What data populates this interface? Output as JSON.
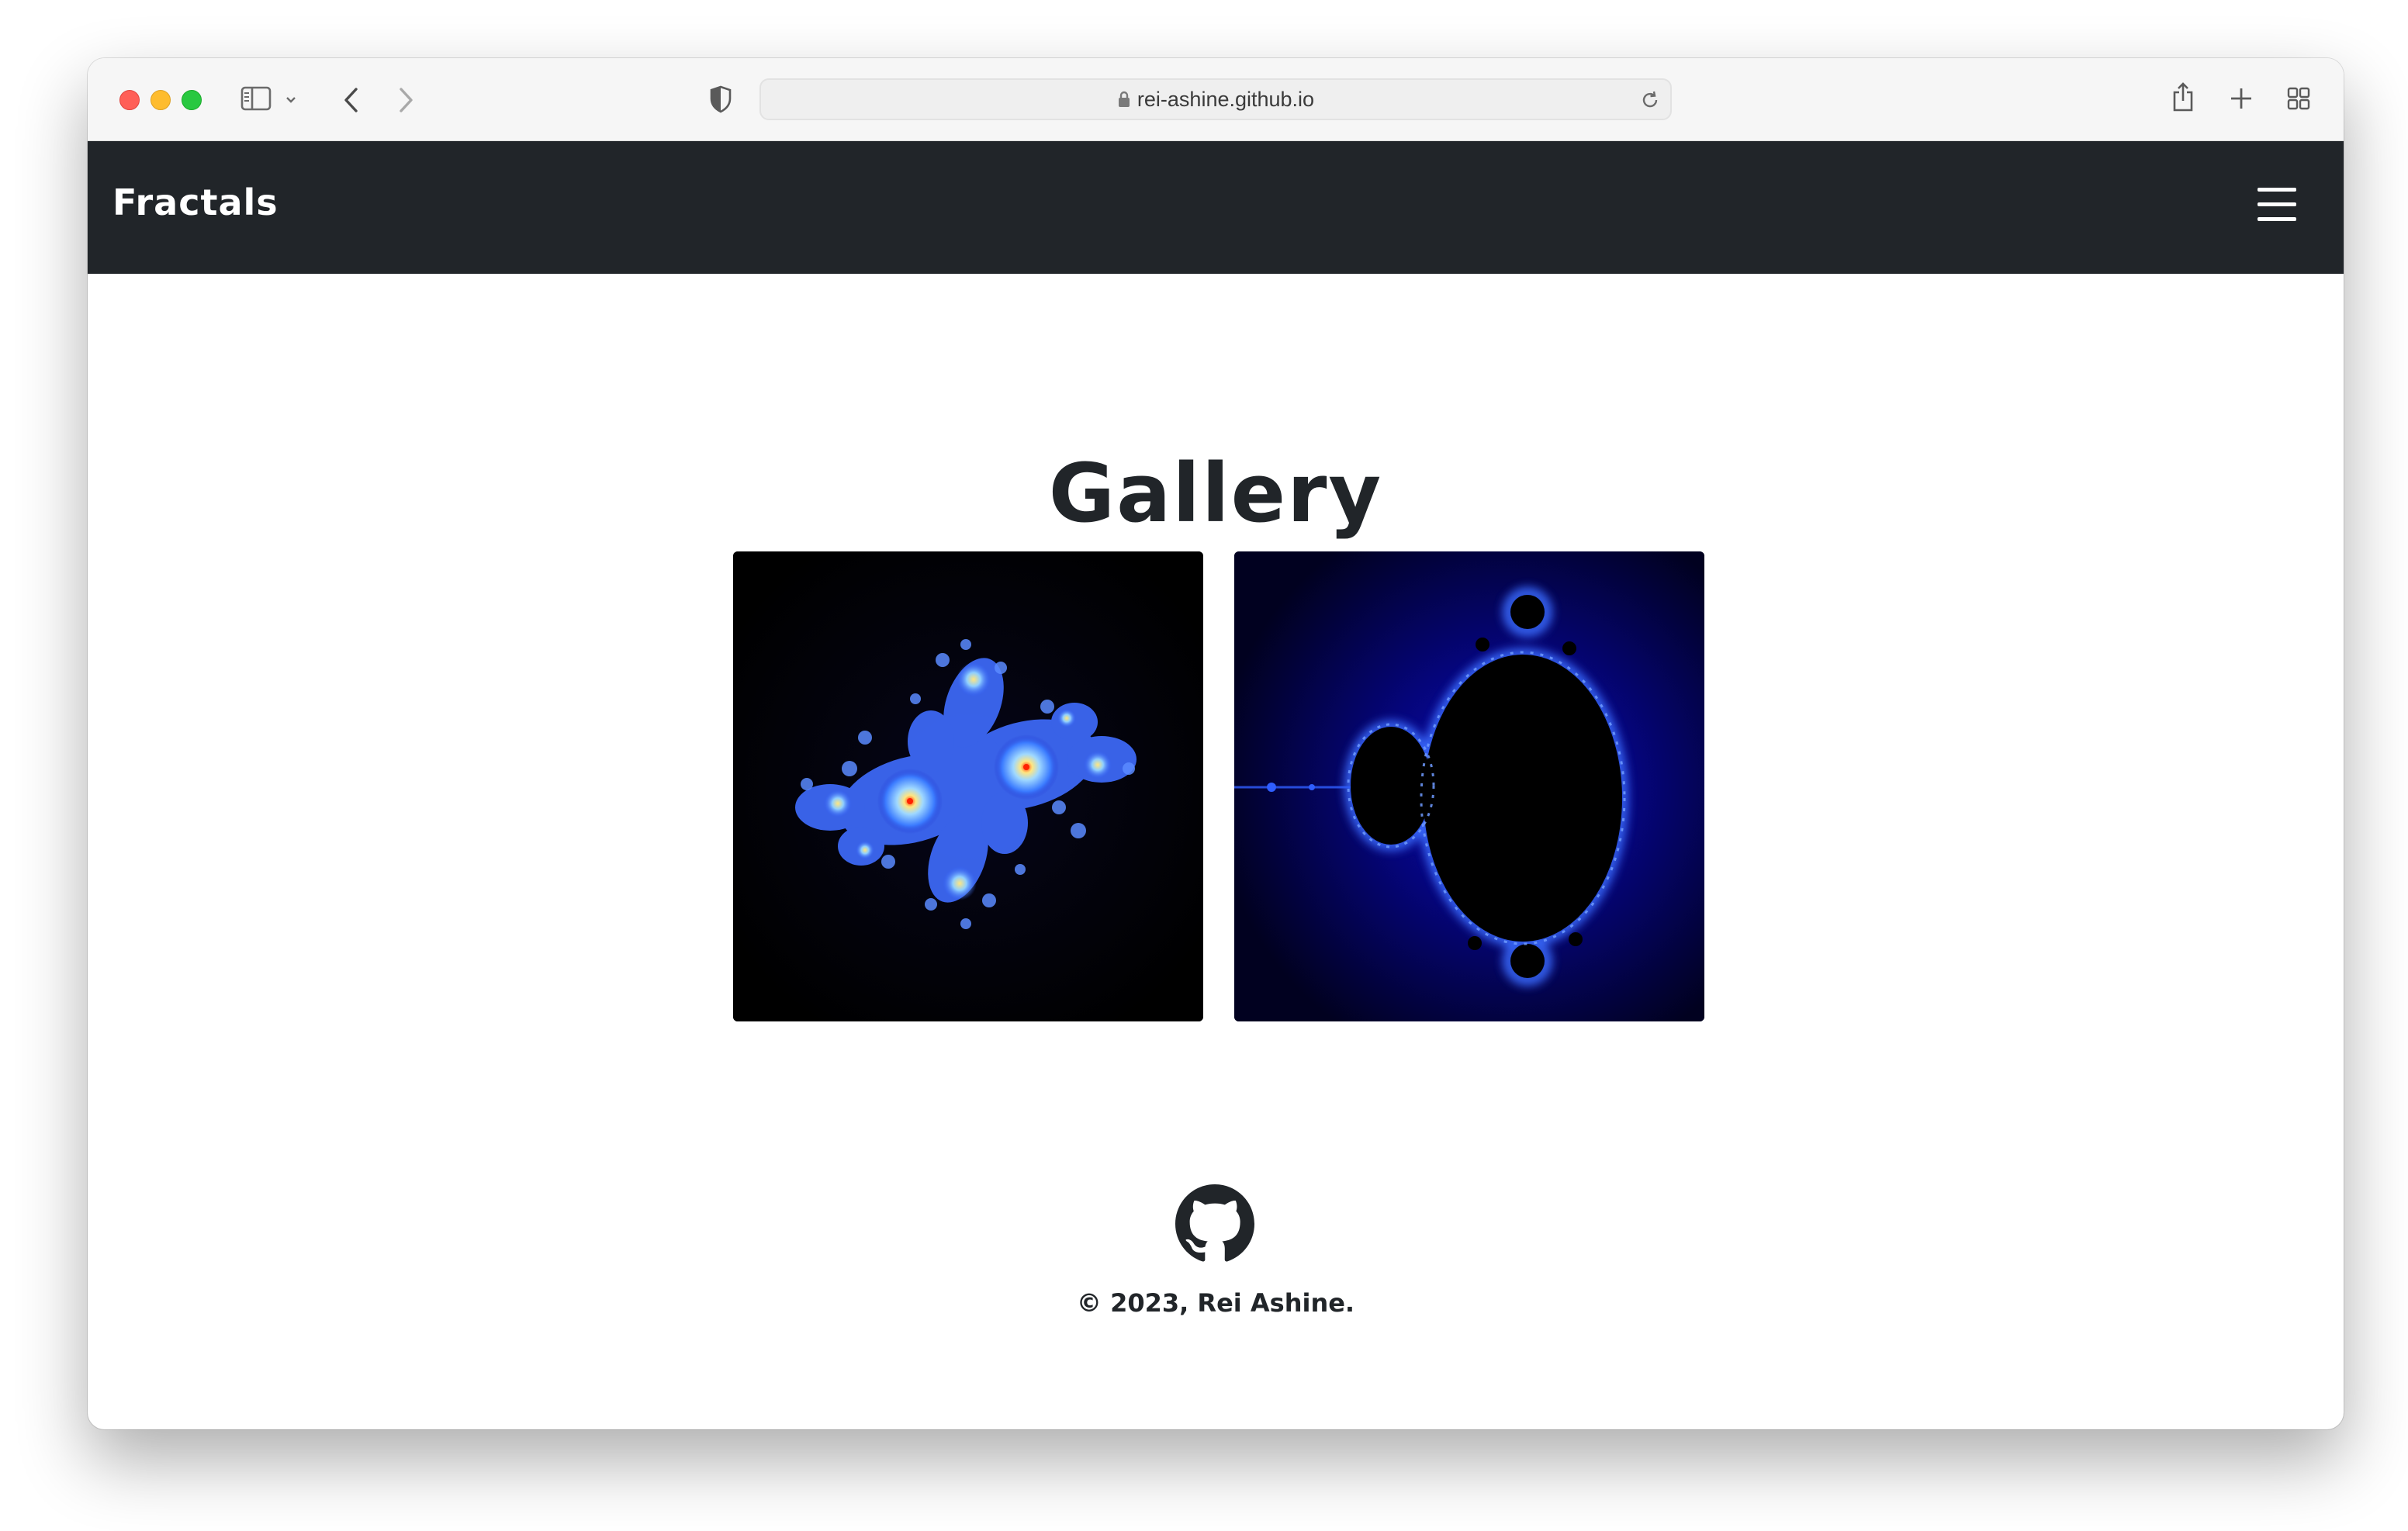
{
  "browser": {
    "url": "rei-ashine.github.io"
  },
  "navbar": {
    "brand": "Fractals",
    "menu_icon": "hamburger-menu-icon"
  },
  "main": {
    "title": "Gallery",
    "images": [
      {
        "name": "julia-set",
        "description_icon": "image"
      },
      {
        "name": "mandelbrot-set",
        "description_icon": "image"
      }
    ]
  },
  "footer": {
    "icon": "github-icon",
    "copyright": "© 2023, Rei Ashine."
  },
  "colors": {
    "navbar_bg": "#212529",
    "text_dark": "#212529",
    "fractal_blue": "#3f6dff"
  }
}
